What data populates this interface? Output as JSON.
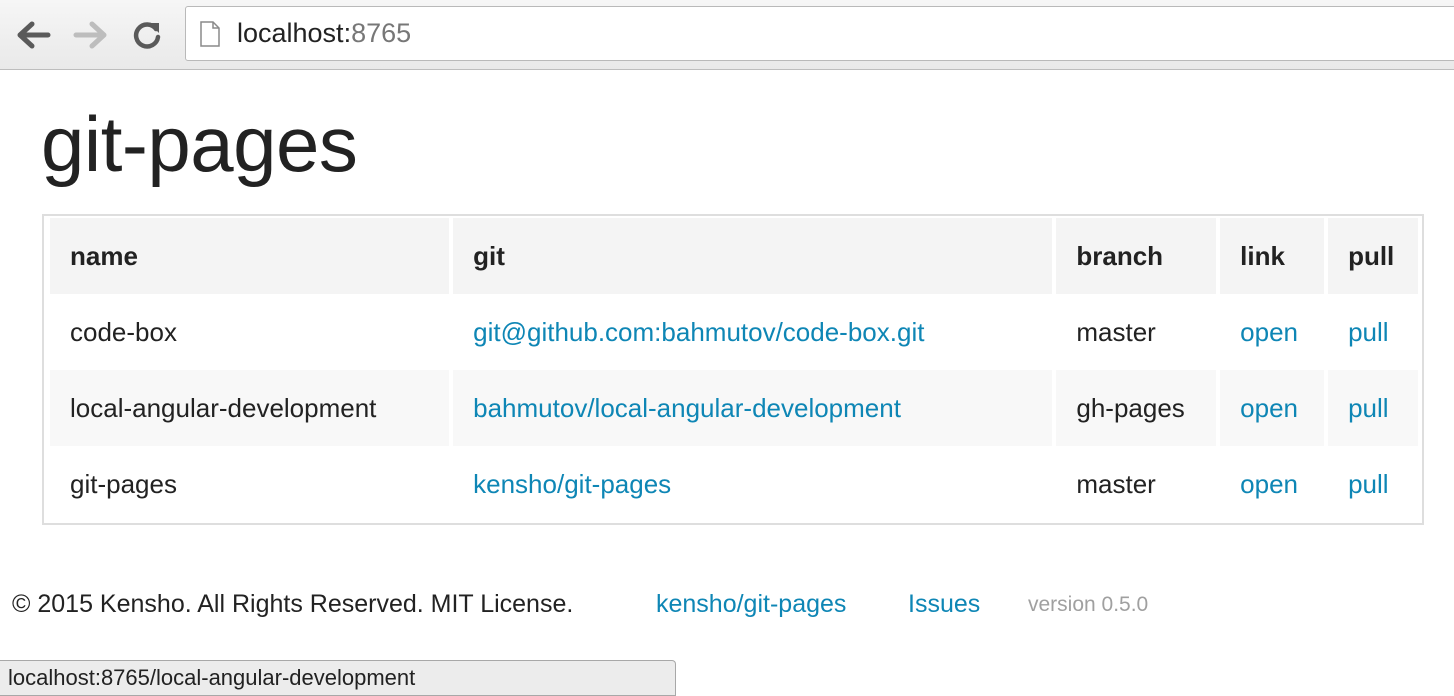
{
  "browser": {
    "url_host": "localhost:",
    "url_port": "8765"
  },
  "page": {
    "title": "git-pages"
  },
  "table": {
    "headers": {
      "name": "name",
      "git": "git",
      "branch": "branch",
      "link": "link",
      "pull": "pull"
    },
    "rows": [
      {
        "name": "code-box",
        "git": "git@github.com:bahmutov/code-box.git",
        "branch": "master",
        "link": "open",
        "pull": "pull"
      },
      {
        "name": "local-angular-development",
        "git": "bahmutov/local-angular-development",
        "branch": "gh-pages",
        "link": "open",
        "pull": "pull"
      },
      {
        "name": "git-pages",
        "git": "kensho/git-pages",
        "branch": "master",
        "link": "open",
        "pull": "pull"
      }
    ]
  },
  "footer": {
    "copyright": "© 2015 Kensho. All Rights Reserved. MIT License.",
    "repo_link": "kensho/git-pages",
    "issues_link": "Issues",
    "version": "version 0.5.0"
  },
  "status_bar": {
    "text": "localhost:8765/local-angular-development"
  },
  "colors": {
    "link": "#0e86b5",
    "header_bg": "#f4f4f4",
    "stripe_bg": "#f8f8f8"
  },
  "icons": [
    "back-arrow-icon",
    "forward-arrow-icon",
    "reload-icon",
    "page-icon"
  ]
}
